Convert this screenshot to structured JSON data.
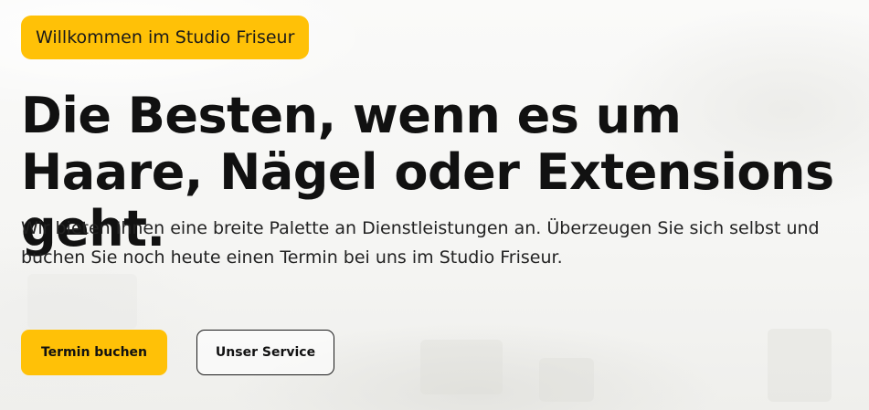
{
  "hero": {
    "badge": "Willkommen im Studio Friseur",
    "headline": "Die Besten, wenn es um Haare, Nägel oder Extensions geht.",
    "subtext": "Wir bieten Ihnen eine breite Palette an Dienstleistungen an. Überzeugen Sie sich selbst und buchen Sie noch heute einen Termin bei uns im Studio Friseur.",
    "primary_button": "Termin buchen",
    "secondary_button": "Unser Service"
  },
  "colors": {
    "accent": "#ffc107",
    "text": "#111111",
    "background": "#f7f7f6"
  }
}
